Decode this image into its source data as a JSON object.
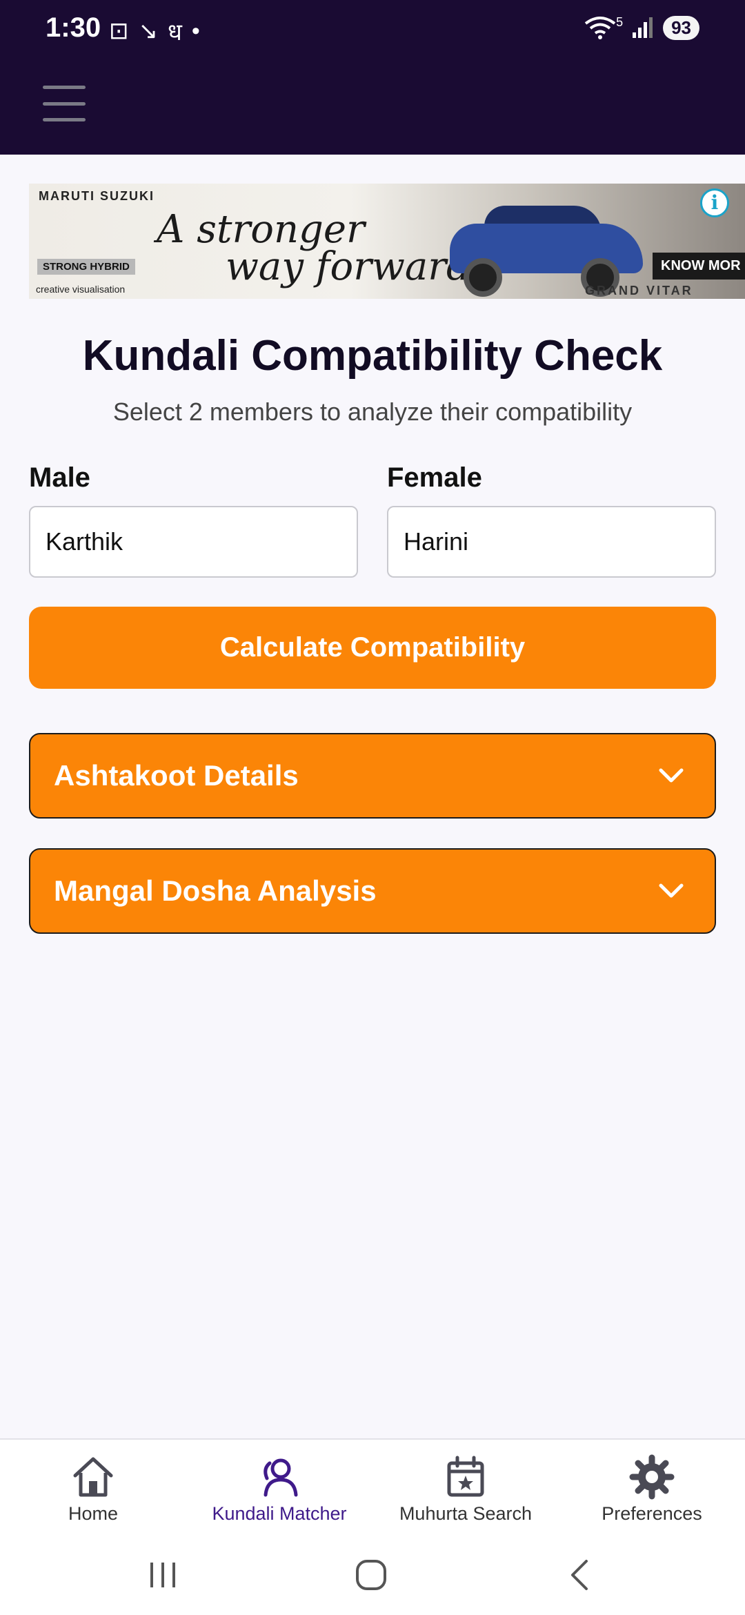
{
  "status_bar": {
    "time": "1:30",
    "left_icons": [
      "⊡",
      "↘",
      "ध",
      "•"
    ],
    "battery": "93",
    "network_label": "5"
  },
  "ad": {
    "brand": "MARUTI SUZUKI",
    "headline_line1": "A stronger",
    "headline_line2": "way forward.",
    "tag": "STRONG HYBRID",
    "note": "creative visualisation",
    "cta": "KNOW MOR",
    "sub_brand": "GRAND VITAR",
    "info_glyph": "i"
  },
  "page": {
    "title": "Kundali Compatibility Check",
    "subtitle": "Select 2 members to analyze their compatibility"
  },
  "form": {
    "male_label": "Male",
    "male_value": "Karthik",
    "female_label": "Female",
    "female_value": "Harini",
    "submit_label": "Calculate Compatibility"
  },
  "sections": [
    {
      "label": "Ashtakoot Details"
    },
    {
      "label": "Mangal Dosha Analysis"
    }
  ],
  "bottom_nav": {
    "items": [
      {
        "label": "Home",
        "icon": "home-icon",
        "active": false
      },
      {
        "label": "Kundali Matcher",
        "icon": "kundali-matcher-icon",
        "active": true
      },
      {
        "label": "Muhurta Search",
        "icon": "calendar-star-icon",
        "active": false
      },
      {
        "label": "Preferences",
        "icon": "gear-icon",
        "active": false
      }
    ]
  },
  "colors": {
    "header_bg": "#1a0b33",
    "accent_orange": "#fb8507",
    "active_nav": "#3f1a8a",
    "page_bg": "#f8f7fc"
  }
}
